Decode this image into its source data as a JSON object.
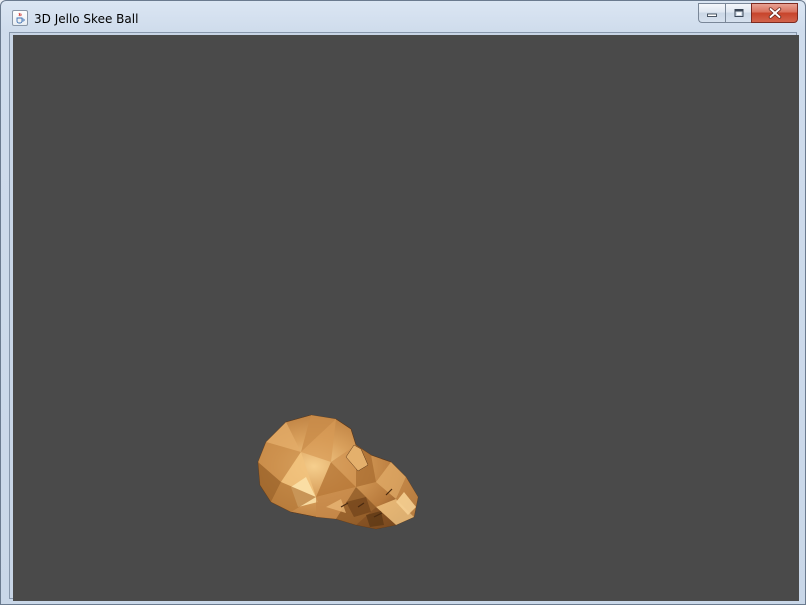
{
  "window": {
    "title": "3D Jello Skee Ball",
    "icon": "java-cup-icon",
    "controls": {
      "minimize": "minimize-icon",
      "maximize": "maximize-icon",
      "close": "close-icon"
    }
  },
  "viewport": {
    "background_color": "#4a4a4a",
    "object": "3d-head-model",
    "object_color": "#d49a55"
  }
}
